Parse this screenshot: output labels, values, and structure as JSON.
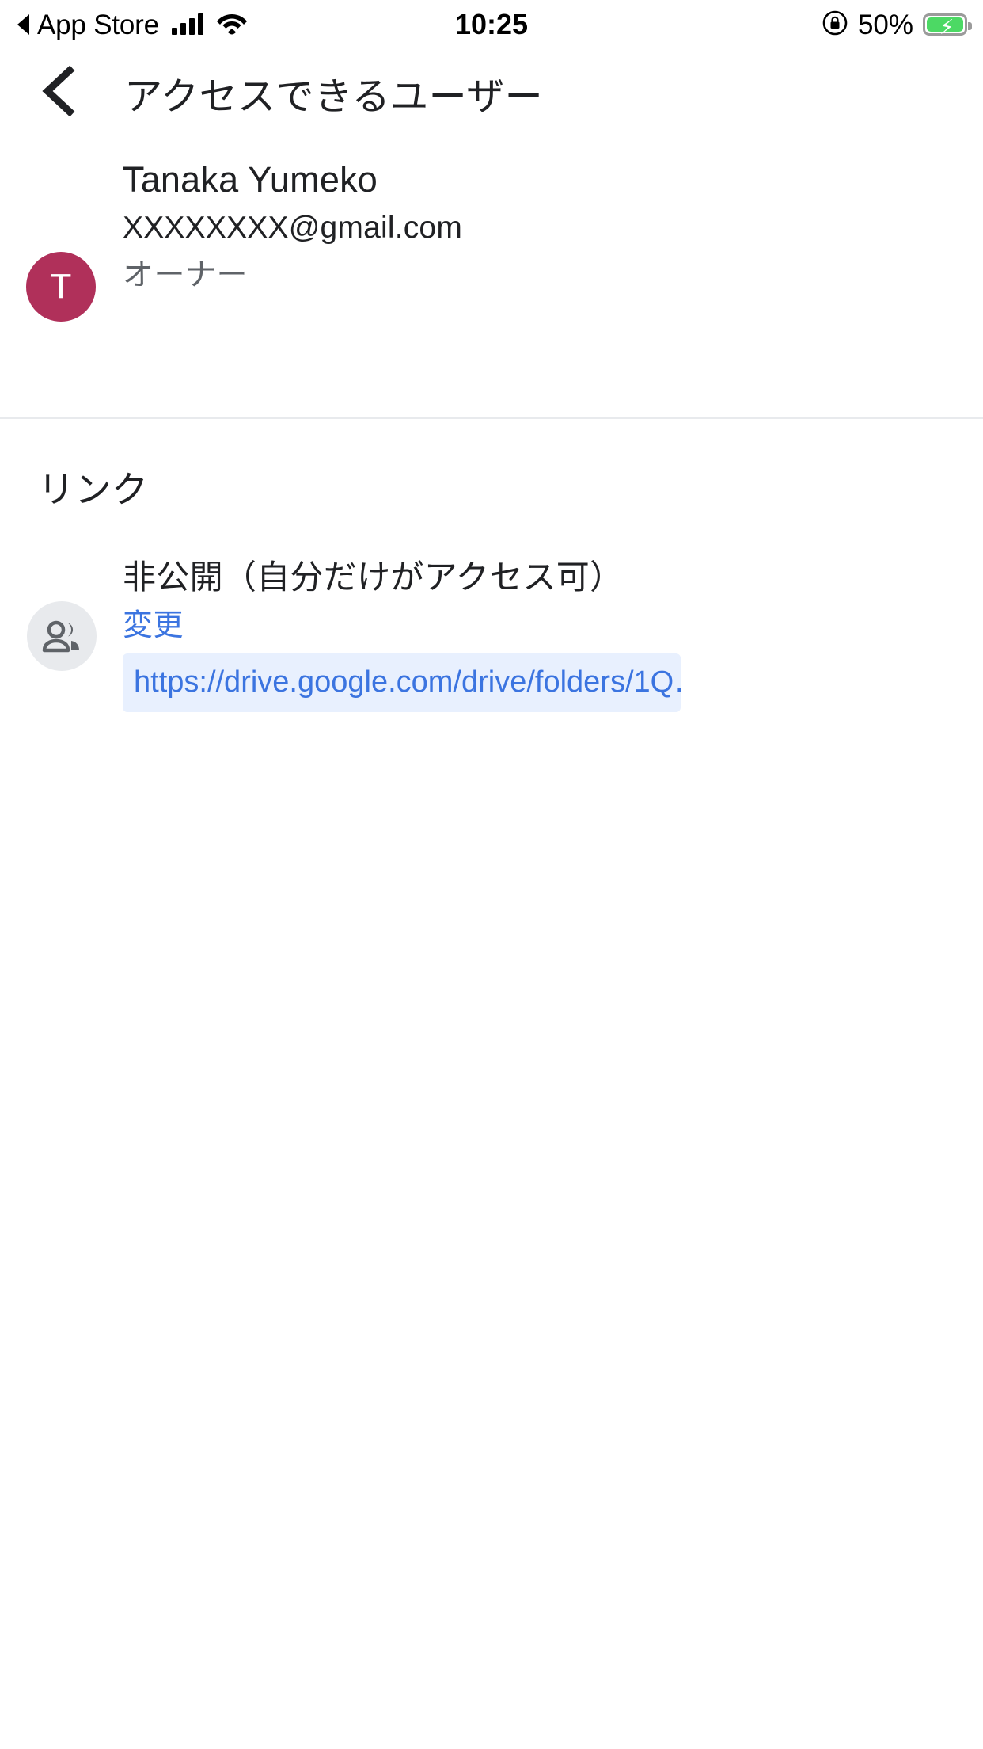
{
  "status_bar": {
    "back_app_label": "App Store",
    "back_arrow_icon": "triangle-left-icon",
    "signal_icon": "cellular-signal-icon",
    "wifi_icon": "wifi-icon",
    "time": "10:25",
    "rotation_lock_icon": "rotation-lock-icon",
    "battery_percent": "50%",
    "battery_icon": "battery-charging-icon",
    "battery_bolt_glyph": "⚡",
    "battery_fill_color": "#4cd964"
  },
  "nav": {
    "back_icon": "chevron-left-icon",
    "title": "アクセスできるユーザー"
  },
  "people": {
    "rows": [
      {
        "avatar_initial": "T",
        "avatar_color": "#b0305a",
        "name": "Tanaka Yumeko",
        "email": "XXXXXXXX@gmail.com",
        "role": "オーナー"
      }
    ]
  },
  "link_section": {
    "header": "リンク",
    "icon": "people-group-icon",
    "access_label": "非公開（自分だけがアクセス可）",
    "change_label": "変更",
    "change_link_color": "#3b74e0",
    "url": "https://drive.google.com/drive/folders/1Q…",
    "url_chip_background": "#e8f0fe"
  }
}
